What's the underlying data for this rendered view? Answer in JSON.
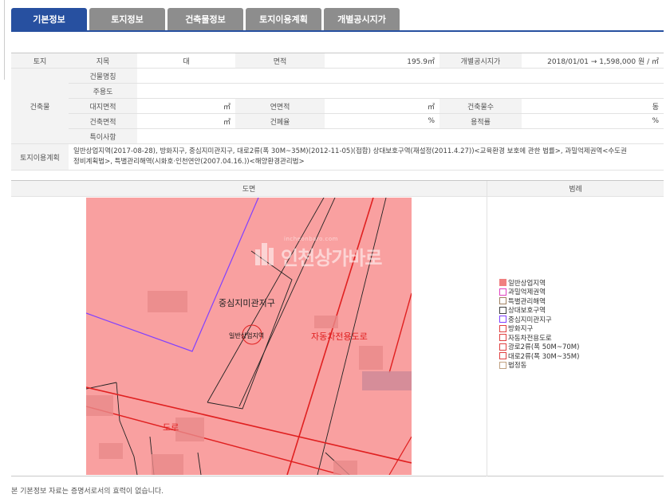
{
  "tabs": [
    "기본정보",
    "토지정보",
    "건축물정보",
    "토지이용계획",
    "개별공시지가"
  ],
  "active_tab": 0,
  "land": {
    "row_label": "토지",
    "jimok_label": "지목",
    "jimok_value": "대",
    "area_label": "면적",
    "area_value": "195.9㎡",
    "price_label": "개별공시지가",
    "price_value": "2018/01/01 → 1,598,000 원 / ㎡"
  },
  "building": {
    "row_label": "건축물",
    "name_label": "건물명칭",
    "use_label": "주용도",
    "site_area_label": "대지면적",
    "site_area_unit": "㎡",
    "floor_area_label": "연면적",
    "floor_area_unit": "㎡",
    "floors_label": "건축물수",
    "floors_unit": "동",
    "building_area_label": "건축면적",
    "building_area_unit": "㎡",
    "coverage_label": "건폐율",
    "coverage_unit": "%",
    "far_label": "용적률",
    "far_unit": "%",
    "special_label": "특이사항"
  },
  "plan": {
    "row_label": "토지이용계획",
    "text_line1": "일반상업지역(2017-08-28), 방화지구, 중심지미관지구, 대로2류(폭 30M~35M)(2012-11-05)(접합) 상대보호구역(재설정(2011.4.27))<교육환경 보호에 관한 법률>, 과밀억제권역<수도권",
    "text_line2": "정비계획법>, 특별관리해역(시화호·인천연안(2007.04.16.))<해양환경관리법>"
  },
  "map": {
    "header": "도면",
    "legend_header": "범례",
    "labels": {
      "district": "중심지미관지구",
      "zone": "일반상업지역",
      "road_main": "자동차전용도로",
      "road_partial": "도로"
    },
    "watermark_small": "incheonbaro.com",
    "watermark": "인천상가바로"
  },
  "legend": [
    {
      "label": "일반상업지역",
      "color": "#f08080",
      "fill": true
    },
    {
      "label": "과밀억제권역",
      "color": "#e040c0",
      "fill": false
    },
    {
      "label": "특별관리해역",
      "color": "#a08060",
      "fill": false
    },
    {
      "label": "상대보호구역",
      "color": "#404040",
      "fill": false
    },
    {
      "label": "중심지미관지구",
      "color": "#8040ff",
      "fill": false
    },
    {
      "label": "방화지구",
      "color": "#e04040",
      "fill": false
    },
    {
      "label": "자동차전용도로",
      "color": "#e04040",
      "fill": false
    },
    {
      "label": "광로2류(폭 50M~70M)",
      "color": "#e04040",
      "fill": false
    },
    {
      "label": "대로2류(폭 30M~35M)",
      "color": "#e04040",
      "fill": false
    },
    {
      "label": "법정동",
      "color": "#c0a080",
      "fill": false
    }
  ],
  "footnote": "본 기본정보 자료는 증명서로서의 효력이 없습니다.",
  "colors": {
    "tab_active": "#2750a0",
    "tab_inactive": "#8d8d8d",
    "map_fill": "#f9a0a0"
  }
}
